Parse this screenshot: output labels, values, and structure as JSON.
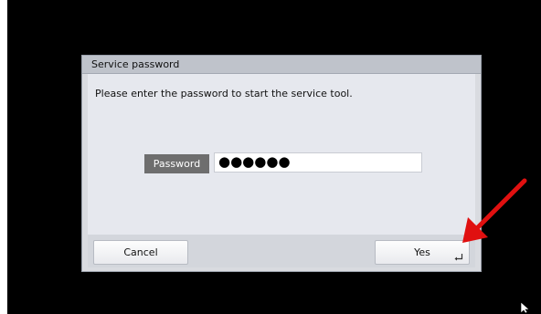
{
  "dialog": {
    "title": "Service password",
    "message": "Please enter the password to start the service tool.",
    "password_label": "Password",
    "password_value": "●●●●●●",
    "cancel_label": "Cancel",
    "yes_label": "Yes"
  },
  "colors": {
    "annotation_arrow": "#e01010",
    "screen_background": "#000000",
    "dialog_background": "#e6e8ee",
    "label_background": "#6e6e6e"
  },
  "icons": {
    "yes_button": "enter-return-icon",
    "annotation": "red-arrow-icon",
    "pointer": "mouse-cursor-icon"
  }
}
